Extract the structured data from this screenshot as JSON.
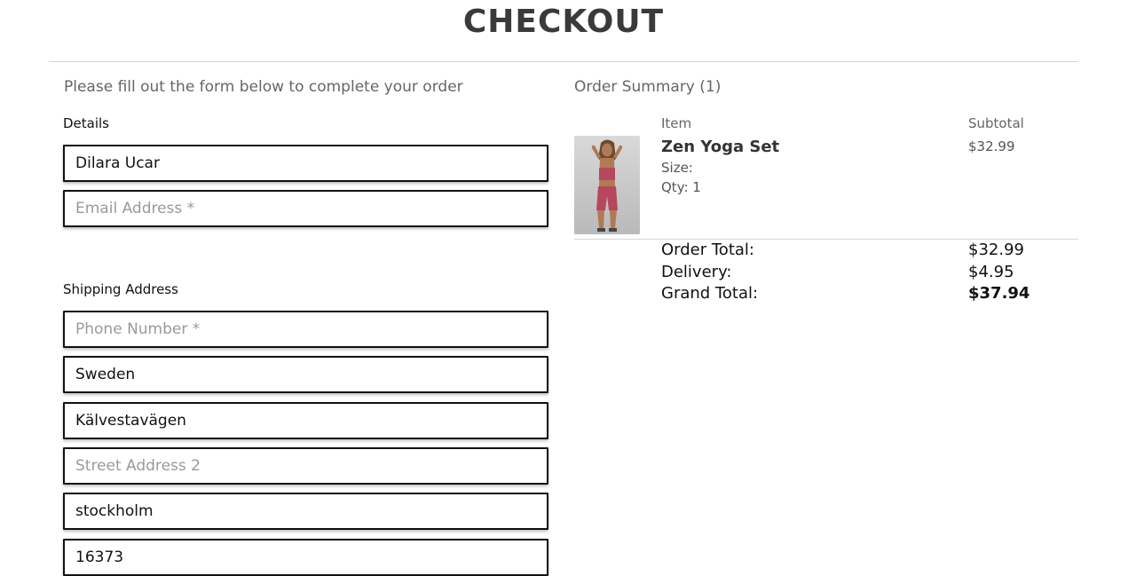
{
  "header": {
    "title": "CHECKOUT"
  },
  "form": {
    "intro": "Please fill out the form below to complete your order",
    "details_label": "Details",
    "name": {
      "value": "Dilara Ucar",
      "placeholder": ""
    },
    "email": {
      "value": "",
      "placeholder": "Email Address *"
    },
    "shipping_label": "Shipping Address",
    "phone": {
      "value": "",
      "placeholder": "Phone Number *"
    },
    "country": {
      "value": "Sweden",
      "placeholder": ""
    },
    "street1": {
      "value": "Kälvestavägen",
      "placeholder": ""
    },
    "street2": {
      "value": "",
      "placeholder": "Street Address 2"
    },
    "city": {
      "value": "stockholm",
      "placeholder": ""
    },
    "postcode": {
      "value": "16373",
      "placeholder": ""
    }
  },
  "summary": {
    "title": "Order Summary (1)",
    "col_item": "Item",
    "col_subtotal": "Subtotal",
    "product": {
      "name": "Zen Yoga Set",
      "size": "Size:",
      "qty": "Qty: 1",
      "price": "$32.99"
    },
    "order_total_label": "Order Total:",
    "order_total_value": "$32.99",
    "delivery_label": "Delivery:",
    "delivery_value": "$4.95",
    "grand_total_label": "Grand Total:",
    "grand_total_value": "$37.94"
  },
  "colors": {
    "title": "#3a3a3a",
    "product_outfit": "#b5485d",
    "field_border": "#111111"
  }
}
